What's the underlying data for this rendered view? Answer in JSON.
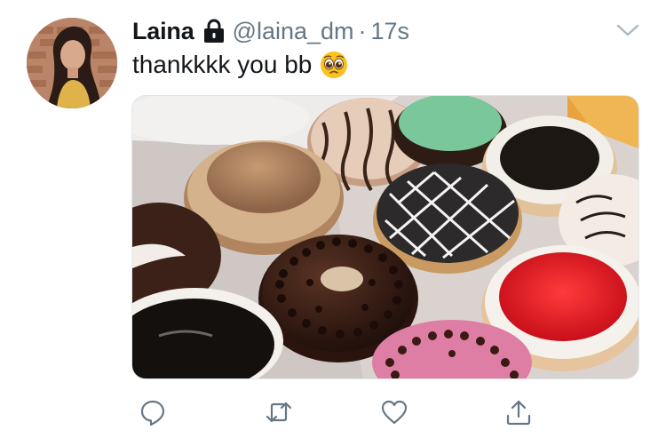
{
  "tweet": {
    "author_name": "Laina",
    "handle": "@laina_dm",
    "separator": "·",
    "time": "17s",
    "text": "thankkkk you bb",
    "emoji": "pleading-face-emoji",
    "protected": true
  },
  "icons": {
    "lock": "lock-icon",
    "chevron": "chevron-down-icon",
    "reply": "reply-icon",
    "retweet": "retweet-icon",
    "like": "heart-icon",
    "share": "share-icon"
  },
  "colors": {
    "text": "#14171a",
    "secondary": "#657786",
    "icon": "#657786",
    "border": "#e1e8ed"
  }
}
